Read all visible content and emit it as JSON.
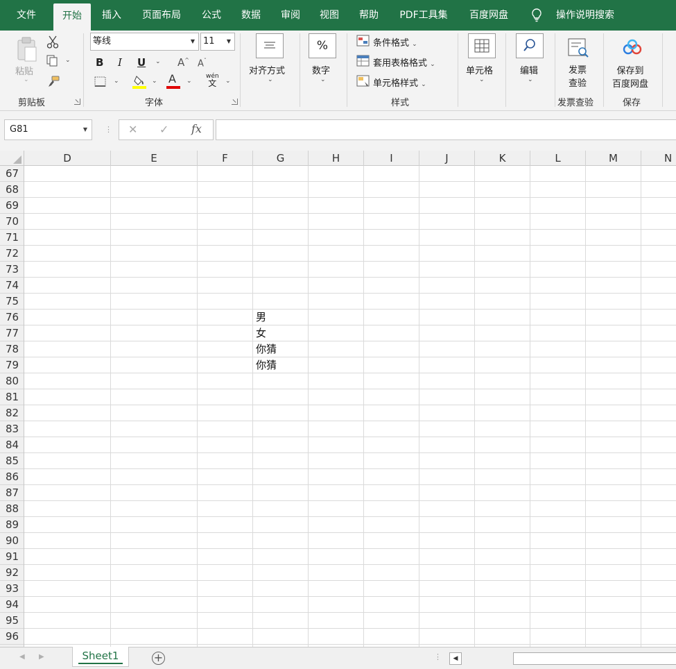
{
  "menu": {
    "tabs": [
      "文件",
      "开始",
      "插入",
      "页面布局",
      "公式",
      "数据",
      "审阅",
      "视图",
      "帮助",
      "PDF工具集",
      "百度网盘"
    ],
    "active": "开始",
    "search": "操作说明搜索"
  },
  "ribbon": {
    "clipboard": {
      "paste": "粘贴",
      "label": "剪贴板"
    },
    "font": {
      "name": "等线",
      "size": "11",
      "bold": "B",
      "italic": "I",
      "underline": "U",
      "grow": "A",
      "shrink": "A",
      "label": "字体",
      "font_color": "A",
      "phonetic_top": "wén",
      "phonetic_bottom": "文"
    },
    "align": {
      "label": "对齐方式"
    },
    "number": {
      "symbol": "%",
      "label": "数字"
    },
    "styles": {
      "conditional": "条件格式",
      "table": "套用表格格式",
      "cell": "单元格样式",
      "label": "样式"
    },
    "cells": {
      "label": "单元格"
    },
    "editing": {
      "label": "编辑"
    },
    "invoice": {
      "line1": "发票",
      "line2": "查验",
      "label": "发票查验"
    },
    "save": {
      "line1": "保存到",
      "line2": "百度网盘",
      "label": "保存"
    },
    "colors": {
      "fill_bar": "#ffff00",
      "font_bar": "#e00000",
      "brand": "#217346"
    }
  },
  "formula_bar": {
    "name_box": "G81",
    "fx": "fx",
    "cancel": "✕",
    "enter": "✓",
    "value": ""
  },
  "grid": {
    "columns": [
      "D",
      "E",
      "F",
      "G",
      "H",
      "I",
      "J",
      "K",
      "L",
      "M",
      "N"
    ],
    "rows": [
      "67",
      "68",
      "69",
      "70",
      "71",
      "72",
      "73",
      "74",
      "75",
      "76",
      "77",
      "78",
      "79",
      "80",
      "81",
      "82",
      "83",
      "84",
      "85",
      "86",
      "87",
      "88",
      "89",
      "90",
      "91",
      "92",
      "93",
      "94",
      "95",
      "96"
    ],
    "cells": [
      {
        "ref": "G76",
        "value": "男"
      },
      {
        "ref": "G77",
        "value": "女"
      },
      {
        "ref": "G78",
        "value": "你猜"
      },
      {
        "ref": "G79",
        "value": "你猜"
      }
    ]
  },
  "sheets": {
    "tabs": [
      "Sheet1"
    ],
    "active": "Sheet1"
  }
}
